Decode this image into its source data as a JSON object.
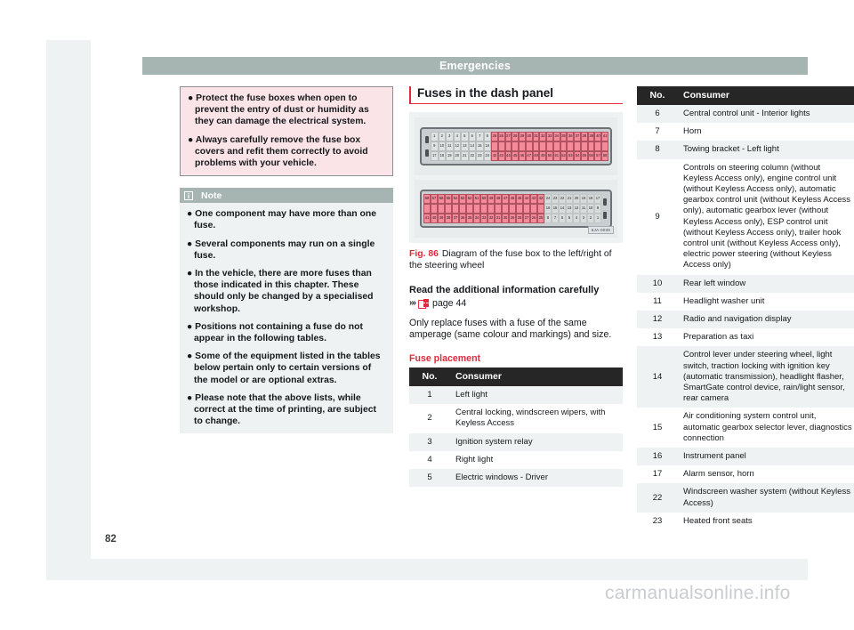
{
  "document": {
    "chapter_banner": "Emergencies",
    "page_number": "82",
    "watermark": "carmanualsonline.info"
  },
  "warning_box": {
    "bullets": [
      "Protect the fuse boxes when open to prevent the entry of dust or humidity as they can damage the electrical system.",
      "Always carefully remove the fuse box covers and refit them correctly to avoid problems with your vehicle."
    ]
  },
  "note_box": {
    "title": "Note",
    "icon": "info-icon",
    "bullets": [
      "One component may have more than one fuse.",
      "Several components may run on a single fuse.",
      "In the vehicle, there are more fuses than those indicated in this chapter. These should only be changed by a specialised workshop.",
      "Positions not containing a fuse do not appear in the following tables.",
      "Some of the equipment listed in the tables below pertain only to certain versions of the model or are optional extras.",
      "Please note that the above lists, while correct at the time of printing, are subject to change."
    ]
  },
  "main": {
    "section_title": "Fuses in the dash panel",
    "figure": {
      "label": "Fig. 86",
      "caption": "Diagram of the fuse box to the left/right of the steering wheel",
      "code": "6JA-0039",
      "box_top": {
        "row1_left": [
          "1",
          "2",
          "3",
          "4",
          "5",
          "6",
          "7",
          "8"
        ],
        "row2_left": [
          "9",
          "10",
          "11",
          "12",
          "13",
          "14",
          "15",
          "16"
        ],
        "row3_left": [
          "17",
          "18",
          "19",
          "20",
          "21",
          "22",
          "23",
          "24"
        ],
        "row1_right": [
          "25",
          "26",
          "27",
          "28",
          "29",
          "30",
          "31",
          "32",
          "33",
          "34",
          "35",
          "36",
          "37",
          "38",
          "39",
          "40",
          "41"
        ],
        "row3_right": [
          "42",
          "43",
          "44",
          "45",
          "46",
          "47",
          "48",
          "49",
          "50",
          "51",
          "52",
          "53",
          "54",
          "55",
          "56",
          "57",
          "58"
        ]
      },
      "box_bottom": {
        "row1_left": [
          "58",
          "57",
          "56",
          "55",
          "54",
          "53",
          "52",
          "51",
          "50",
          "49",
          "48",
          "47",
          "46",
          "45",
          "44",
          "43",
          "42"
        ],
        "row3_left": [
          "41",
          "40",
          "39",
          "38",
          "37",
          "36",
          "35",
          "34",
          "33",
          "32",
          "31",
          "30",
          "29",
          "28",
          "27",
          "26",
          "25"
        ],
        "row1_right": [
          "24",
          "23",
          "22",
          "21",
          "20",
          "19",
          "18",
          "17"
        ],
        "row2_right": [
          "16",
          "15",
          "14",
          "13",
          "12",
          "11",
          "10",
          "9"
        ],
        "row3_right": [
          "8",
          "7",
          "6",
          "5",
          "4",
          "3",
          "2",
          "1"
        ]
      }
    },
    "read_info_heading": "Read the additional information carefully",
    "ref_chevron": "›››",
    "ref_icon": "book-page-icon",
    "ref_page": "page 44",
    "body_paragraph": "Only replace fuses with a fuse of the same amperage (same colour and markings) and size.",
    "fuse_placement_heading": "Fuse placement"
  },
  "table_left": {
    "headers": {
      "no": "No.",
      "consumer": "Consumer"
    },
    "rows": [
      {
        "no": "1",
        "consumer": "Left light"
      },
      {
        "no": "2",
        "consumer": "Central locking, windscreen wipers, with Keyless Access"
      },
      {
        "no": "3",
        "consumer": "Ignition system relay"
      },
      {
        "no": "4",
        "consumer": "Right light"
      },
      {
        "no": "5",
        "consumer": "Electric windows - Driver"
      }
    ]
  },
  "table_right": {
    "headers": {
      "no": "No.",
      "consumer": "Consumer"
    },
    "rows": [
      {
        "no": "6",
        "consumer": "Central control unit - Interior lights"
      },
      {
        "no": "7",
        "consumer": "Horn"
      },
      {
        "no": "8",
        "consumer": "Towing bracket - Left light"
      },
      {
        "no": "9",
        "consumer": "Controls on steering column (without Keyless Access only), engine control unit (without Keyless Access only), automatic gearbox control unit (without Keyless Access only), automatic gearbox lever (without Keyless Access only), ESP control unit (without Keyless Access only), trailer hook control unit (without Keyless Access only), electric power steering (without Keyless Access only)"
      },
      {
        "no": "10",
        "consumer": "Rear left window"
      },
      {
        "no": "11",
        "consumer": "Headlight washer unit"
      },
      {
        "no": "12",
        "consumer": "Radio and navigation display"
      },
      {
        "no": "13",
        "consumer": "Preparation as taxi"
      },
      {
        "no": "14",
        "consumer": "Control lever under steering wheel, light switch, traction locking with ignition key (automatic transmission), headlight flasher, SmartGate control device, rain/light sensor, rear camera"
      },
      {
        "no": "15",
        "consumer": "Air conditioning system control unit, automatic gearbox selector lever, diagnostics connection"
      },
      {
        "no": "16",
        "consumer": "Instrument panel"
      },
      {
        "no": "17",
        "consumer": "Alarm sensor, horn"
      },
      {
        "no": "22",
        "consumer": "Windscreen washer system (without Keyless Access)"
      },
      {
        "no": "23",
        "consumer": "Heated front seats"
      }
    ]
  },
  "colors": {
    "banner": "#a6b4b2",
    "accent_red": "#e3293c",
    "warning_bg": "#fbe4e7",
    "note_bg": "#eef2f3",
    "table_header": "#262626",
    "fuse_pink": "#f58a9b"
  }
}
